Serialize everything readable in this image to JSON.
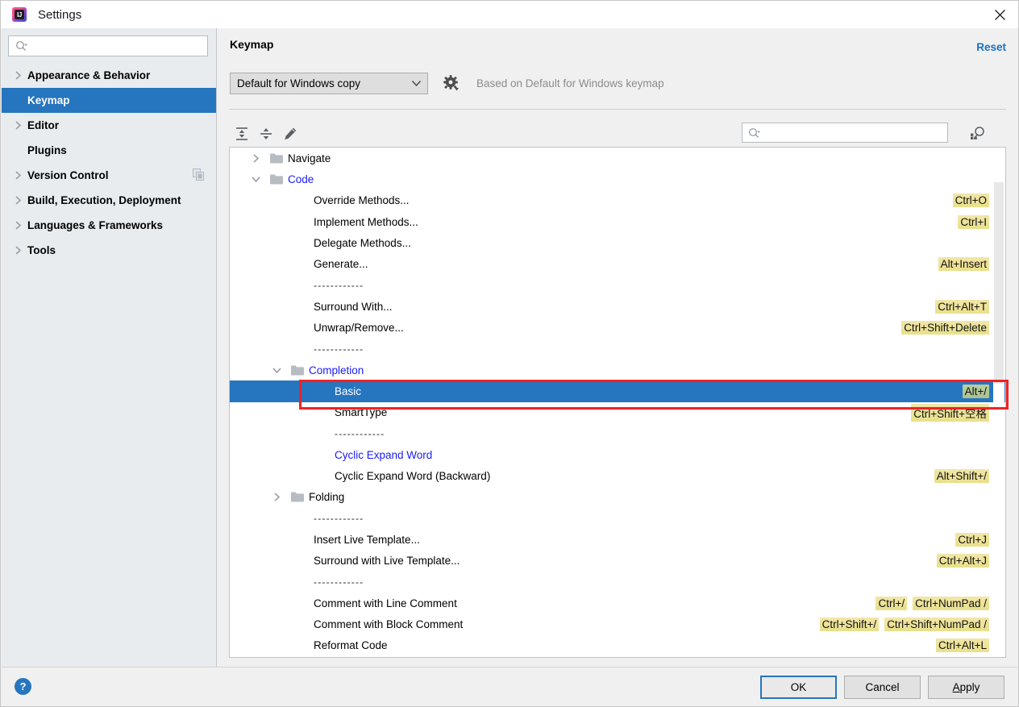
{
  "window": {
    "title": "Settings",
    "app_icon": "intellij-idea-icon",
    "close_icon": "close-icon"
  },
  "sidebar": {
    "search": {
      "placeholder": "",
      "value": "",
      "icon": "search-icon"
    },
    "items": [
      {
        "label": "Appearance & Behavior",
        "expandable": true,
        "selected": false
      },
      {
        "label": "Keymap",
        "expandable": false,
        "selected": true
      },
      {
        "label": "Editor",
        "expandable": true,
        "selected": false
      },
      {
        "label": "Plugins",
        "expandable": false,
        "selected": false
      },
      {
        "label": "Version Control",
        "expandable": true,
        "selected": false,
        "badge": "copy-icon"
      },
      {
        "label": "Build, Execution, Deployment",
        "expandable": true,
        "selected": false
      },
      {
        "label": "Languages & Frameworks",
        "expandable": true,
        "selected": false
      },
      {
        "label": "Tools",
        "expandable": true,
        "selected": false
      }
    ]
  },
  "main": {
    "page_title": "Keymap",
    "reset_label": "Reset",
    "keymap_select": {
      "value": "Default for Windows copy",
      "chevron": "chevron-down-icon"
    },
    "gear_icon": "gear-icon",
    "based_on": "Based on Default for Windows keymap",
    "toolbar": {
      "expand_all_icon": "expand-all-icon",
      "collapse_all_icon": "collapse-all-icon",
      "edit_shortcut_icon": "pencil-icon",
      "search": {
        "placeholder": "",
        "value": "",
        "icon": "search-icon"
      },
      "find_by_shortcut_icon": "find-by-shortcut-icon"
    }
  },
  "tree": {
    "rows": [
      {
        "label": "Navigate",
        "indent": 1,
        "type": "folder",
        "state": "collapsed",
        "color": "black",
        "shortcuts": []
      },
      {
        "label": "Code",
        "indent": 1,
        "type": "folder",
        "state": "expanded",
        "color": "blue",
        "shortcuts": []
      },
      {
        "label": "Override Methods...",
        "indent": 3,
        "type": "action",
        "color": "black",
        "shortcuts": [
          "Ctrl+O"
        ]
      },
      {
        "label": "Implement Methods...",
        "indent": 3,
        "type": "action",
        "color": "black",
        "shortcuts": [
          "Ctrl+I"
        ]
      },
      {
        "label": "Delegate Methods...",
        "indent": 3,
        "type": "action",
        "color": "black",
        "shortcuts": []
      },
      {
        "label": "Generate...",
        "indent": 3,
        "type": "action",
        "color": "black",
        "shortcuts": [
          "Alt+Insert"
        ]
      },
      {
        "label": "------------",
        "indent": 3,
        "type": "separator",
        "color": "black",
        "shortcuts": []
      },
      {
        "label": "Surround With...",
        "indent": 3,
        "type": "action",
        "color": "black",
        "shortcuts": [
          "Ctrl+Alt+T"
        ]
      },
      {
        "label": "Unwrap/Remove...",
        "indent": 3,
        "type": "action",
        "color": "black",
        "shortcuts": [
          "Ctrl+Shift+Delete"
        ]
      },
      {
        "label": "------------",
        "indent": 3,
        "type": "separator",
        "color": "black",
        "shortcuts": []
      },
      {
        "label": "Completion",
        "indent": 2,
        "type": "folder",
        "state": "expanded",
        "color": "blue",
        "shortcuts": []
      },
      {
        "label": "Basic",
        "indent": 3,
        "type": "action",
        "color": "black",
        "selected": true,
        "shortcuts": [
          "Alt+/"
        ]
      },
      {
        "label": "SmartType",
        "indent": 3,
        "type": "action",
        "color": "black",
        "shortcuts": [
          "Ctrl+Shift+空格"
        ]
      },
      {
        "label": "------------",
        "indent": 3,
        "type": "separator",
        "color": "black",
        "shortcuts": []
      },
      {
        "label": "Cyclic Expand Word",
        "indent": 3,
        "type": "action",
        "color": "blue",
        "shortcuts": []
      },
      {
        "label": "Cyclic Expand Word (Backward)",
        "indent": 3,
        "type": "action",
        "color": "black",
        "shortcuts": [
          "Alt+Shift+/"
        ]
      },
      {
        "label": "Folding",
        "indent": 2,
        "type": "folder",
        "state": "collapsed",
        "color": "black",
        "shortcuts": []
      },
      {
        "label": "------------",
        "indent": 3,
        "type": "separator",
        "color": "black",
        "shortcuts": []
      },
      {
        "label": "Insert Live Template...",
        "indent": 3,
        "type": "action",
        "color": "black",
        "shortcuts": [
          "Ctrl+J"
        ]
      },
      {
        "label": "Surround with Live Template...",
        "indent": 3,
        "type": "action",
        "color": "black",
        "shortcuts": [
          "Ctrl+Alt+J"
        ]
      },
      {
        "label": "------------",
        "indent": 3,
        "type": "separator",
        "color": "black",
        "shortcuts": []
      },
      {
        "label": "Comment with Line Comment",
        "indent": 3,
        "type": "action",
        "color": "black",
        "shortcuts": [
          "Ctrl+/",
          "Ctrl+NumPad /"
        ]
      },
      {
        "label": "Comment with Block Comment",
        "indent": 3,
        "type": "action",
        "color": "black",
        "shortcuts": [
          "Ctrl+Shift+/",
          "Ctrl+Shift+NumPad /"
        ]
      },
      {
        "label": "Reformat Code",
        "indent": 3,
        "type": "action",
        "color": "black",
        "shortcuts": [
          "Ctrl+Alt+L"
        ]
      }
    ]
  },
  "annotation": {
    "type": "red-rectangle",
    "target": "Basic"
  },
  "footer": {
    "help_label": "?",
    "ok_label": "OK",
    "cancel_label": "Cancel",
    "apply_label": "Apply",
    "apply_mnemonic": "A"
  },
  "colors": {
    "selection_blue": "#2675bf",
    "link_blue": "#1a71c4",
    "tree_link_blue": "#1a1aff",
    "shortcut_yellow": "#e8e08a",
    "annotation_red": "#f22222",
    "sidebar_bg": "#e8ecef"
  }
}
